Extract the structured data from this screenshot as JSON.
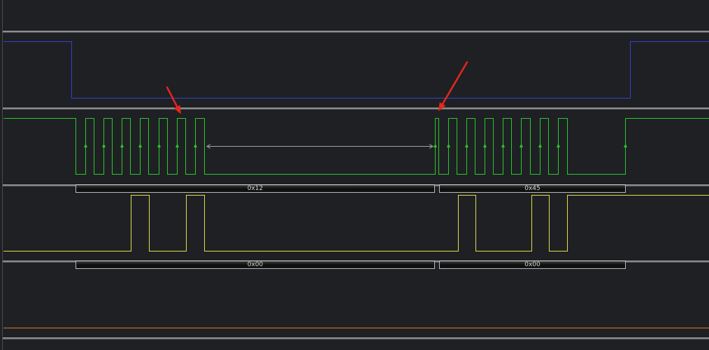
{
  "theme": {
    "background": "#1f2024"
  },
  "channels": [
    {
      "color": "#3343d0"
    },
    {
      "color": "#29c92b"
    },
    {
      "color": "#e6dc4a"
    },
    {
      "color": "#d9792c"
    }
  ],
  "decoder_rows": [
    {
      "bytes": [
        {
          "label": "0x12"
        },
        {
          "label": "0x45"
        }
      ]
    },
    {
      "bytes": [
        {
          "label": "0x00"
        },
        {
          "label": "0x00"
        }
      ]
    }
  ],
  "measurement": {
    "color": "#a3a3a3"
  },
  "annotation": {
    "color": "#e8261c"
  }
}
